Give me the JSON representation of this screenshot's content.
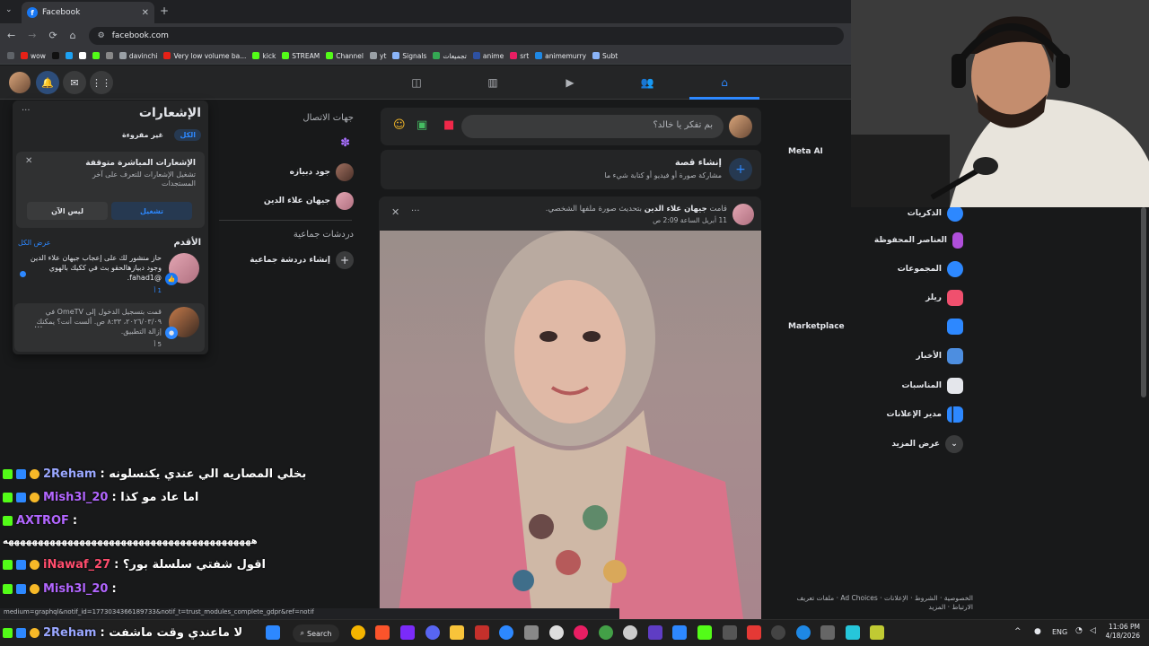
{
  "browser": {
    "tab_title": "Facebook",
    "url": "facebook.com",
    "bookmarks": [
      "wow",
      "davinchi",
      "Very low volume ba...",
      "kick",
      "STREAM",
      "Channel",
      "yt",
      "Signals",
      "تجميعات",
      "anime",
      "srt",
      "animemurry",
      "Subt"
    ]
  },
  "notifications": {
    "title": "الإشعارات",
    "tab_all": "الكل",
    "tab_unread": "غير مقروءة",
    "push_title": "الإشعارات المباشرة متوقفة",
    "push_desc": "تشغيل الإشعارات للتعرف على آخر المستجدات",
    "enable_btn": "تشغيل",
    "not_now_btn": "ليس الآن",
    "older_label": "الأقدم",
    "see_all": "عرض الكل",
    "items": [
      {
        "text": "حاز منشور لك على إعجاب جيهان علاء الدين وجود دبيازهالحقو بث في ككيك بالهوي @fahad1.",
        "time": "1 أ"
      },
      {
        "text": "قمت بتسجيل الدخول إلى OmeTV في ٢٠٢٦/٠٣/٠٩، ٨:٣٣ ص. ألست أنت؟ يمكنك إزالة التطبيق.",
        "time": "5 أ"
      }
    ]
  },
  "contacts": {
    "title": "جهات الاتصال",
    "people": [
      "جود دبيازه",
      "جيهان علاء الدين"
    ],
    "group_title": "دردشات جماعية",
    "create_group": "إنشاء دردشة جماعية"
  },
  "composer": {
    "placeholder": "بم تفكر يا خالد؟",
    "story_title": "إنشاء قصة",
    "story_desc": "مشاركة صورة أو فيديو أو كتابة شيء ما"
  },
  "post": {
    "author": "جيهان علاء الدين",
    "action_prefix": "قامت",
    "action": "بتحديث صورة ملفها الشخصي.",
    "time": "11 أبريل الساعة 2:09 ص"
  },
  "sidebar": {
    "meta_ai": "Meta AI",
    "marketplace": "Marketplace",
    "items": [
      "الذكريات",
      "العناصر المحفوظة",
      "المجموعات",
      "ريلز",
      "الأخبار",
      "المناسبات",
      "مدير الإعلانات",
      "عرض المزيد"
    ],
    "footer": "الخصوصية · الشروط · الإعلانات · Ad Choices · ملفات تعريف الارتباط · المزيد"
  },
  "chat": [
    {
      "user": "2Reham",
      "msg": ": بخلي المصاريه الي عندي يكنسلونه",
      "color": "#9aa7ff"
    },
    {
      "user": "Mish3l_20",
      "msg": ": اما عاد مو كذا",
      "color": "#b266ff"
    },
    {
      "user": "AXTROF",
      "msg": ":",
      "color": "#b266ff"
    },
    {
      "user": "",
      "msg": "ههههههههههههههههههههههههههههههههههههههههههه",
      "color": "#ffffff"
    },
    {
      "user": "iNawaf_27",
      "msg": ": اقول شفتي سلسلة بور؟",
      "color": "#ff4d6d"
    },
    {
      "user": "Mish3l_20",
      "msg": ":",
      "color": "#b266ff"
    },
    {
      "user": "2Reham",
      "msg": ": لا ماعندي وقت ماشفت",
      "color": "#9aa7ff"
    }
  ],
  "status_url": "medium=graphql&notif_id=1773034366189733&notif_t=trust_modules_complete_gdpr&ref=notif",
  "taskbar": {
    "search": "Search",
    "lang": "ENG",
    "time": "11:06 PM",
    "date": "4/18/2026"
  }
}
